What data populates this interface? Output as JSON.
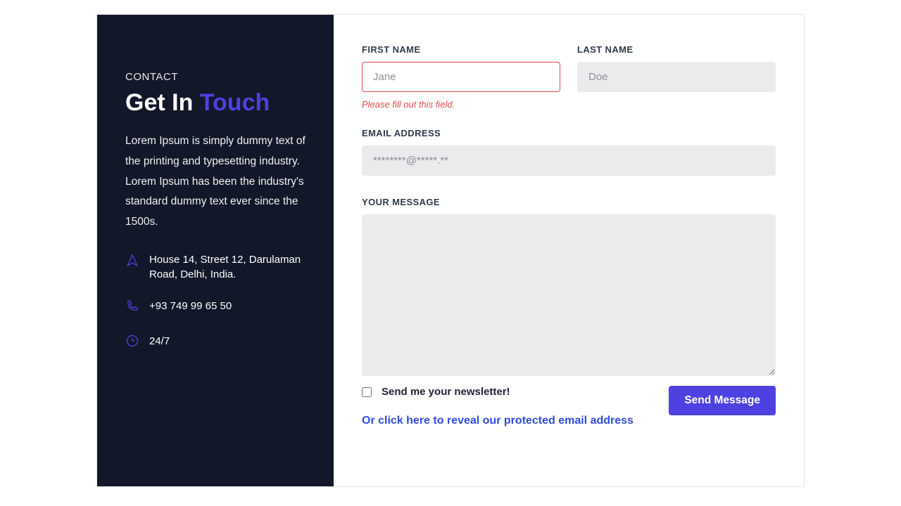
{
  "sidebar": {
    "eyebrow": "CONTACT",
    "heading_part1": "Get In ",
    "heading_part2": "Touch",
    "description": "Lorem Ipsum is simply dummy text of the printing and typesetting industry. Lorem Ipsum has been the industry's standard dummy text ever since the 1500s.",
    "address": "House 14, Street 12, Darulaman Road, Delhi, India.",
    "phone": "+93 749 99 65 50",
    "hours": "24/7"
  },
  "form": {
    "first_name_label": "FIRST NAME",
    "first_name_placeholder": "Jane",
    "first_name_error": "Please fill out this field.",
    "last_name_label": "LAST NAME",
    "last_name_placeholder": "Doe",
    "email_label": "EMAIL ADDRESS",
    "email_placeholder": "********@*****.**",
    "message_label": "YOUR MESSAGE",
    "newsletter_label": "Send me your newsletter!",
    "reveal_link": "Or click here to reveal our protected email address",
    "submit_label": "Send Message"
  }
}
